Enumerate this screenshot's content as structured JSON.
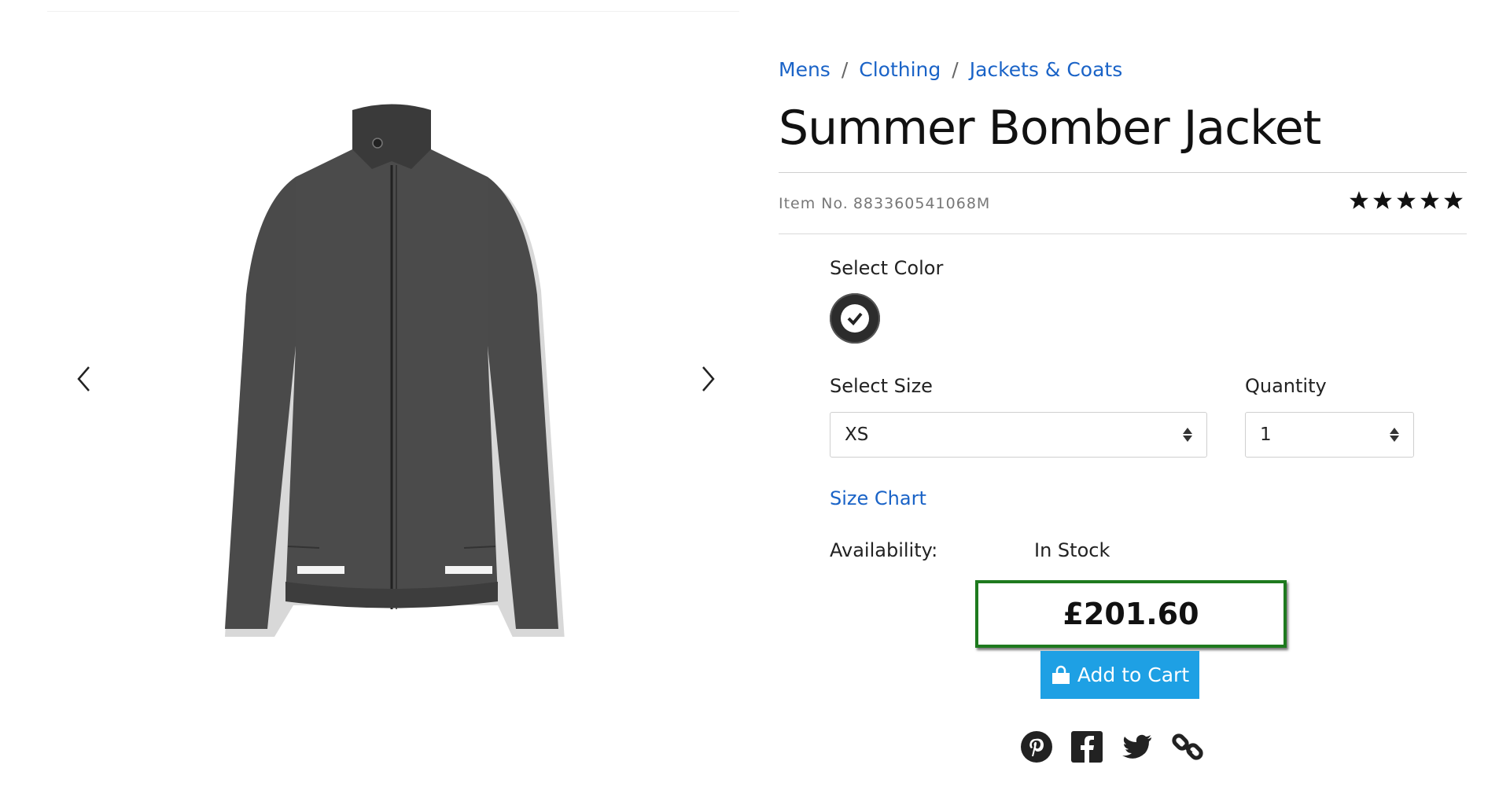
{
  "breadcrumb": [
    "Mens",
    "Clothing",
    "Jackets & Coats"
  ],
  "breadcrumb_separator": "/",
  "product": {
    "title": "Summer Bomber Jacket",
    "item_no_label": "Item No.",
    "item_no": "883360541068M",
    "rating": 5,
    "rating_max": 5,
    "image_icon": "jacket-image"
  },
  "options": {
    "color_label": "Select Color",
    "color_selected": "#2c2c2c",
    "size_label": "Select Size",
    "size_value": "XS",
    "quantity_label": "Quantity",
    "quantity_value": "1",
    "size_chart_link": "Size Chart"
  },
  "availability": {
    "label": "Availability:",
    "value": "In Stock"
  },
  "price": "£201.60",
  "cart": {
    "label": "Add to Cart",
    "icon": "shopping-bag-icon"
  },
  "share_icons": [
    "pinterest-icon",
    "facebook-icon",
    "twitter-icon",
    "link-icon"
  ],
  "colors": {
    "link": "#1a63c7",
    "cart_button": "#1ea0e4",
    "price_border": "#1e7a1e",
    "stars": "#111111"
  }
}
